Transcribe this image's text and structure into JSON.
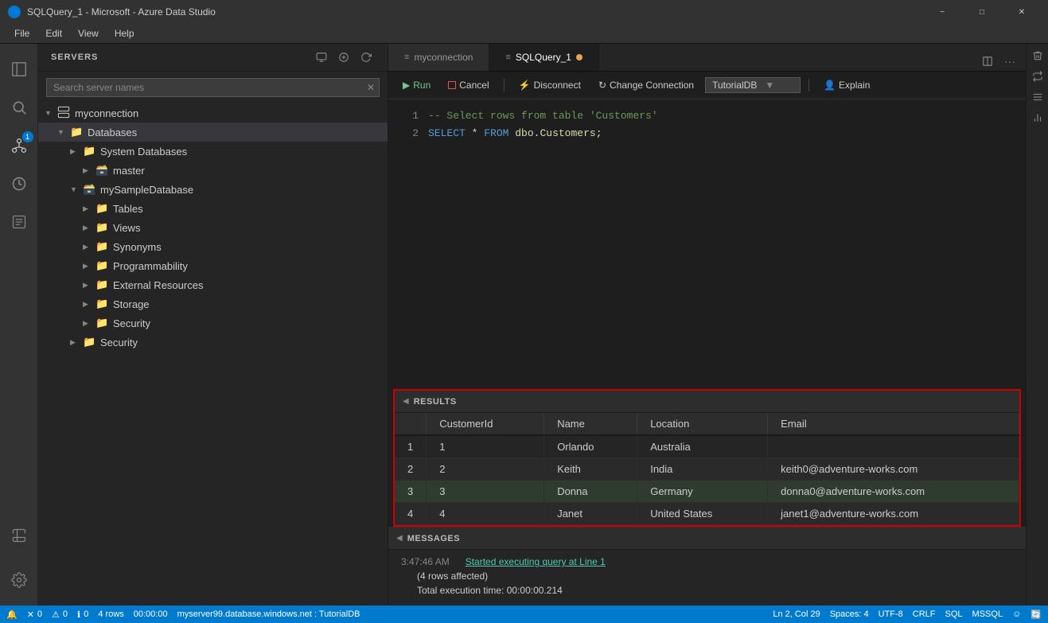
{
  "titleBar": {
    "title": "SQLQuery_1 - Microsoft - Azure Data Studio",
    "controls": [
      "minimize",
      "maximize",
      "close"
    ]
  },
  "menuBar": {
    "items": [
      "File",
      "Edit",
      "View",
      "Help"
    ]
  },
  "activityBar": {
    "icons": [
      {
        "name": "files-icon",
        "symbol": "⬜",
        "active": true
      },
      {
        "name": "search-icon",
        "symbol": "🔍"
      },
      {
        "name": "extensions-icon",
        "symbol": "⬛"
      },
      {
        "name": "git-icon",
        "symbol": "⑂"
      },
      {
        "name": "connections-icon",
        "symbol": "⬡",
        "badge": "1"
      },
      {
        "name": "history-icon",
        "symbol": "🕐"
      },
      {
        "name": "query-icon",
        "symbol": "📋"
      },
      {
        "name": "alert-icon",
        "symbol": "🔔"
      }
    ],
    "bottomIcons": [
      {
        "name": "gear-icon",
        "symbol": "⚙"
      }
    ]
  },
  "sidebar": {
    "title": "SERVERS",
    "searchPlaceholder": "Search server names",
    "tree": [
      {
        "id": "myconnection",
        "label": "myconnection",
        "level": 0,
        "type": "server",
        "expanded": true
      },
      {
        "id": "databases",
        "label": "Databases",
        "level": 1,
        "type": "folder",
        "expanded": true
      },
      {
        "id": "systemdbs",
        "label": "System Databases",
        "level": 2,
        "type": "folder",
        "expanded": false
      },
      {
        "id": "master",
        "label": "master",
        "level": 3,
        "type": "db",
        "expanded": false
      },
      {
        "id": "mysampledb",
        "label": "mySampleDatabase",
        "level": 2,
        "type": "db",
        "expanded": true
      },
      {
        "id": "tables",
        "label": "Tables",
        "level": 3,
        "type": "folder",
        "expanded": false
      },
      {
        "id": "views",
        "label": "Views",
        "level": 3,
        "type": "folder",
        "expanded": false
      },
      {
        "id": "synonyms",
        "label": "Synonyms",
        "level": 3,
        "type": "folder",
        "expanded": false
      },
      {
        "id": "programmability",
        "label": "Programmability",
        "level": 3,
        "type": "folder",
        "expanded": false
      },
      {
        "id": "externalresources",
        "label": "External Resources",
        "level": 3,
        "type": "folder",
        "expanded": false
      },
      {
        "id": "storage",
        "label": "Storage",
        "level": 3,
        "type": "folder",
        "expanded": false
      },
      {
        "id": "security1",
        "label": "Security",
        "level": 3,
        "type": "folder",
        "expanded": false
      },
      {
        "id": "security2",
        "label": "Security",
        "level": 2,
        "type": "folder",
        "expanded": false
      }
    ]
  },
  "tabs": [
    {
      "id": "myconnection-tab",
      "label": "myconnection",
      "active": false
    },
    {
      "id": "sqlquery-tab",
      "label": "SQLQuery_1",
      "active": true,
      "modified": true
    }
  ],
  "toolbar": {
    "runLabel": "Run",
    "cancelLabel": "Cancel",
    "disconnectLabel": "Disconnect",
    "changeConnectionLabel": "Change Connection",
    "database": "TutorialDB",
    "explainLabel": "Explain"
  },
  "editor": {
    "lines": [
      {
        "num": "1",
        "content": "comment",
        "text": "-- Select rows from table 'Customers'"
      },
      {
        "num": "2",
        "content": "sql",
        "text": "SELECT * FROM dbo.Customers;"
      }
    ]
  },
  "results": {
    "sectionTitle": "RESULTS",
    "columns": [
      "CustomerId",
      "Name",
      "Location",
      "Email"
    ],
    "rows": [
      {
        "num": "1",
        "rowNum": "1",
        "cells": [
          "1",
          "Orlando",
          "Australia",
          ""
        ],
        "highlighted": false
      },
      {
        "num": "2",
        "rowNum": "2",
        "cells": [
          "2",
          "Keith",
          "India",
          "keith0@adventure-works.com"
        ],
        "highlighted": false
      },
      {
        "num": "3",
        "rowNum": "3",
        "cells": [
          "3",
          "Donna",
          "Germany",
          "donna0@adventure-works.com"
        ],
        "highlighted": true
      },
      {
        "num": "4",
        "rowNum": "4",
        "cells": [
          "4",
          "Janet",
          "United States",
          "janet1@adventure-works.com"
        ],
        "highlighted": false
      }
    ]
  },
  "messages": {
    "sectionTitle": "MESSAGES",
    "entries": [
      {
        "time": "3:47:46 AM",
        "linkText": "Started executing query at Line 1",
        "extras": [
          "(4 rows affected)",
          "Total execution time: 00:00:00.214"
        ]
      }
    ]
  },
  "statusBar": {
    "rowCount": "4 rows",
    "time": "00:00:00",
    "server": "myserver99.database.windows.net : TutorialDB",
    "position": "Ln 2, Col 29",
    "spaces": "Spaces: 4",
    "encoding": "UTF-8",
    "lineEnding": "CRLF",
    "language": "SQL",
    "mode": "MSSQL",
    "icons": {
      "notifications": "🔔",
      "errors": "0",
      "warnings": "0",
      "info": "0"
    }
  }
}
